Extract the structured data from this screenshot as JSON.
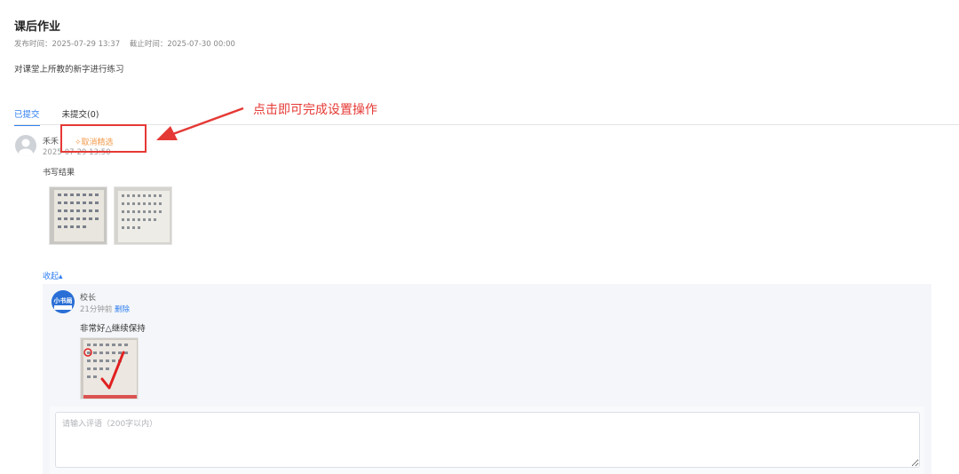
{
  "homework": {
    "title": "课后作业",
    "publish_label": "发布时间：2025-07-29 13:37",
    "deadline_label": "截止时间：2025-07-30 00:00",
    "description": "对课堂上所教的新字进行练习"
  },
  "tabs": [
    {
      "label": "已提交",
      "active": true
    },
    {
      "label": "未提交(0)",
      "active": false
    }
  ],
  "submission": {
    "student_name": "禾禾",
    "submitted_time": "2025-07-29 13:50",
    "cancel_featured_label": "✧取消精选",
    "result_label": "书写结果",
    "images": [
      "writing-sheet-1",
      "writing-sheet-2"
    ]
  },
  "annotation": {
    "callout_text": "点击即可完成设置操作",
    "color": "#e53935"
  },
  "comments": {
    "collapse_label": "收起▴",
    "author": "校长",
    "avatar_text": "小书局",
    "time": "21分钟前",
    "delete_label": "删除",
    "text": "非常好△继续保持",
    "image": "graded-writing-sheet"
  },
  "comment_input": {
    "placeholder": "请输入评语（200字以内）",
    "value": ""
  },
  "colors": {
    "accent": "#2f7ff0",
    "featured": "#f2994a",
    "annotation": "#e53935"
  }
}
